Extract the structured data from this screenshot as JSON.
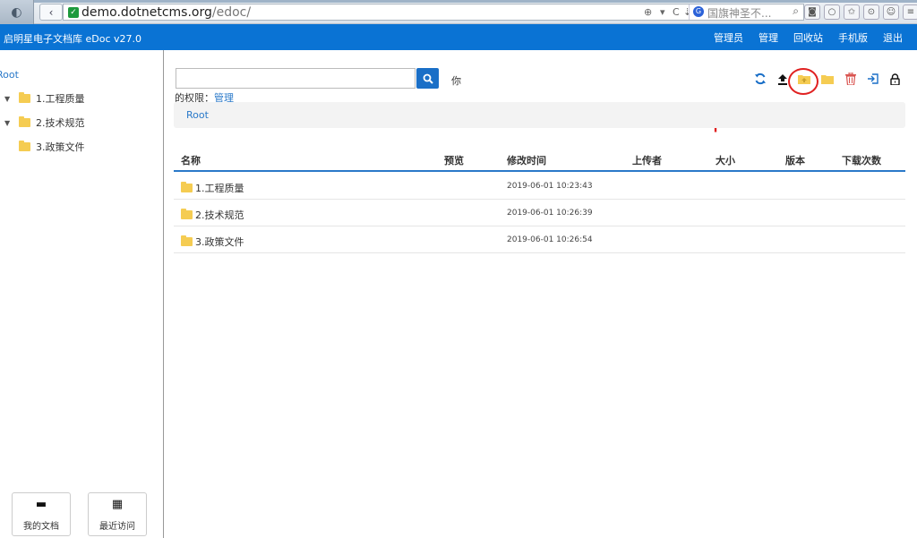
{
  "browser": {
    "url_host": "demo.dotnetcms.org",
    "url_path": "/edoc/",
    "search_query": "国旗神圣不...",
    "engine_glyph": "G"
  },
  "header": {
    "brand": "启明星电子文档库 eDoc v27.0",
    "nav": [
      "管理员",
      "管理",
      "回收站",
      "手机版",
      "退出"
    ]
  },
  "sidebar": {
    "root": "Root",
    "items": [
      {
        "label": "1.工程质量",
        "expandable": true
      },
      {
        "label": "2.技术规范",
        "expandable": true
      },
      {
        "label": "3.政策文件",
        "expandable": false
      }
    ],
    "buttons": [
      {
        "label": "我的文档",
        "icon": "folder-icon"
      },
      {
        "label": "最近访问",
        "icon": "grid-icon"
      }
    ]
  },
  "main": {
    "search_value": "",
    "greeting": "你",
    "permission_label": "的权限：",
    "permission_value": "管理",
    "breadcrumb": "Root",
    "annotation": "upload folder",
    "columns": [
      "名称",
      "预览",
      "修改时间",
      "上传者",
      "大小",
      "版本",
      "下载次数"
    ],
    "rows": [
      {
        "name": "1.工程质量",
        "modified": "2019-06-01 10:23:43"
      },
      {
        "name": "2.技术规范",
        "modified": "2019-06-01 10:26:39"
      },
      {
        "name": "3.政策文件",
        "modified": "2019-06-01 10:26:54"
      }
    ]
  },
  "colors": {
    "header": "#0a73d4",
    "link": "#2a79c9",
    "folder": "#f5cc52",
    "annotation": "#e02020",
    "delete": "#d9534f"
  }
}
